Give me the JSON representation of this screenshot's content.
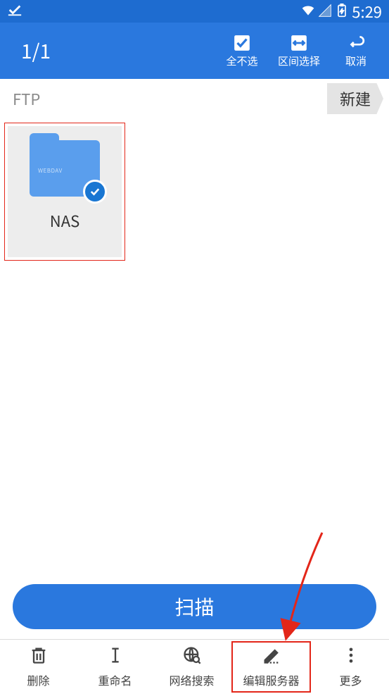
{
  "status_bar": {
    "time": "5:29"
  },
  "toolbar": {
    "count": "1/1",
    "actions": {
      "deselect_all": "全不选",
      "range_select": "区间选择",
      "cancel": "取消"
    }
  },
  "sub_header": {
    "breadcrumb": "FTP",
    "new_button": "新建"
  },
  "items": [
    {
      "label": "NAS",
      "folder_label": "WEBDAV",
      "selected": true
    }
  ],
  "scan_button": "扫描",
  "bottom_bar": {
    "delete": "删除",
    "rename": "重命名",
    "network_search": "网络搜索",
    "edit_server": "编辑服务器",
    "more": "更多"
  }
}
